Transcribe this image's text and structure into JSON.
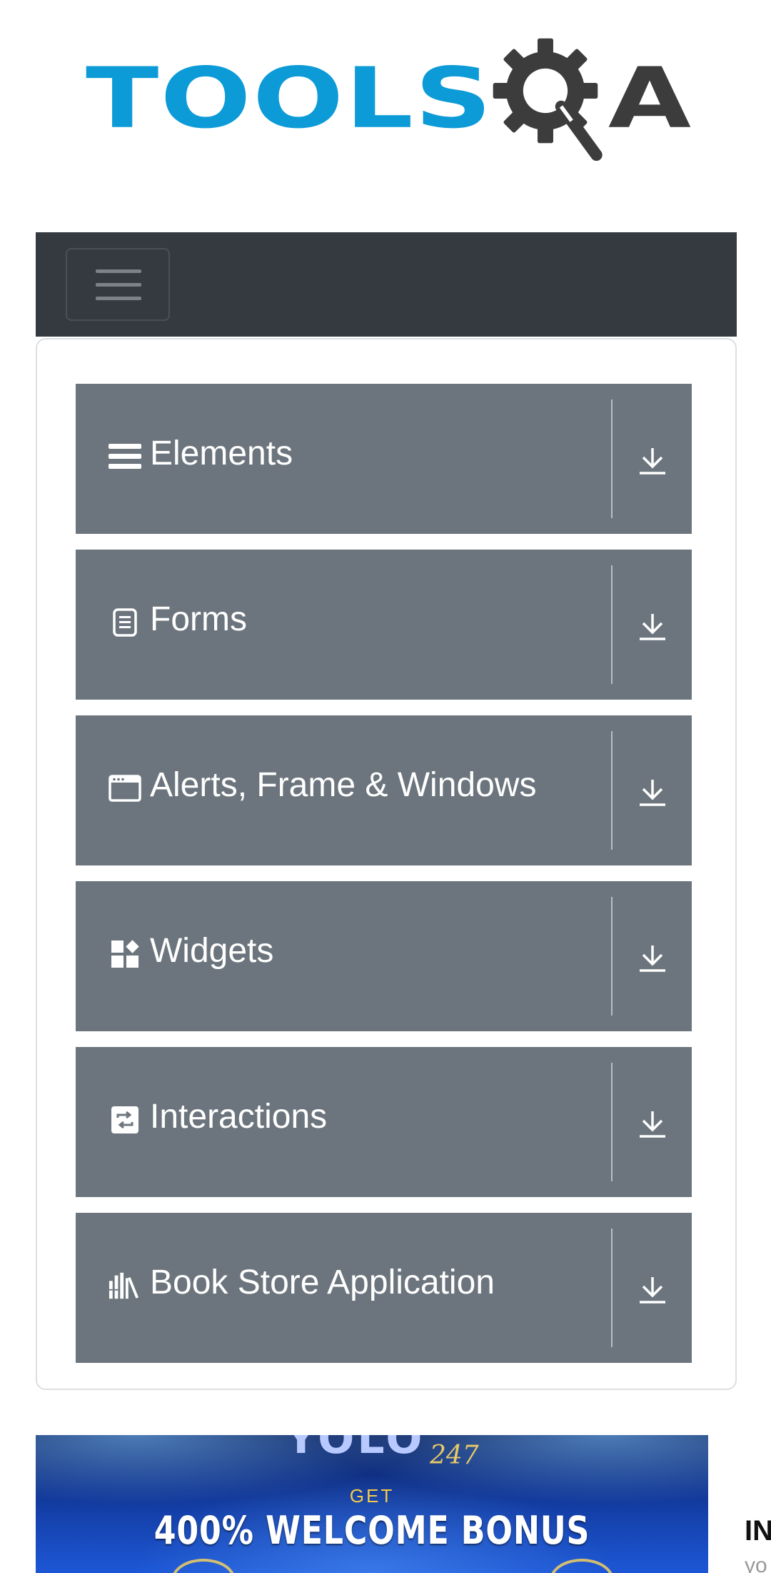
{
  "logo": {
    "text_tools": "TOOLS",
    "text_a": "A"
  },
  "navbar": {
    "toggler_icon": "hamburger-icon"
  },
  "menu": {
    "items": [
      {
        "label": "Elements",
        "icon": "list-icon",
        "toggle_icon": "download-arrow-icon"
      },
      {
        "label": "Forms",
        "icon": "document-icon",
        "toggle_icon": "download-arrow-icon"
      },
      {
        "label": "Alerts, Frame & Windows",
        "icon": "browser-window-icon",
        "toggle_icon": "download-arrow-icon"
      },
      {
        "label": "Widgets",
        "icon": "widgets-icon",
        "toggle_icon": "download-arrow-icon"
      },
      {
        "label": "Interactions",
        "icon": "interactions-icon",
        "toggle_icon": "download-arrow-icon"
      },
      {
        "label": "Book Store Application",
        "icon": "books-icon",
        "toggle_icon": "download-arrow-icon"
      }
    ]
  },
  "ad": {
    "brand": "YOLO",
    "brand_sub": "247",
    "get": "GET",
    "bonus": "400% WELCOME BONUS"
  },
  "sidebar": {
    "title": "IN",
    "subtitle": "yo"
  },
  "colors": {
    "navbar_bg": "#343a40",
    "menu_item_bg": "#6c757d",
    "logo_blue": "#0c9bd7",
    "logo_dark": "#3c3c3c"
  }
}
